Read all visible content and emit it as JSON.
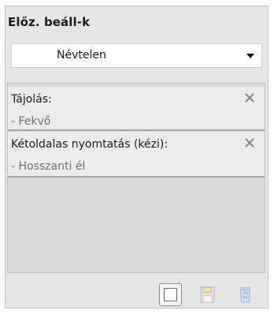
{
  "preset": {
    "title": "Előz. beáll-k",
    "selected": "Névtelen"
  },
  "summary": {
    "items": [
      {
        "name": "Tájolás:",
        "value": "- Fekvő"
      },
      {
        "name": "Kétoldalas nyomtatás (kézi):",
        "value": "- Hosszanti él"
      }
    ]
  },
  "icons": {
    "dropdown": "chevron-down-icon",
    "remove": "close-icon",
    "new": "new-preset-icon",
    "save": "save-icon",
    "delete": "trash-icon"
  }
}
